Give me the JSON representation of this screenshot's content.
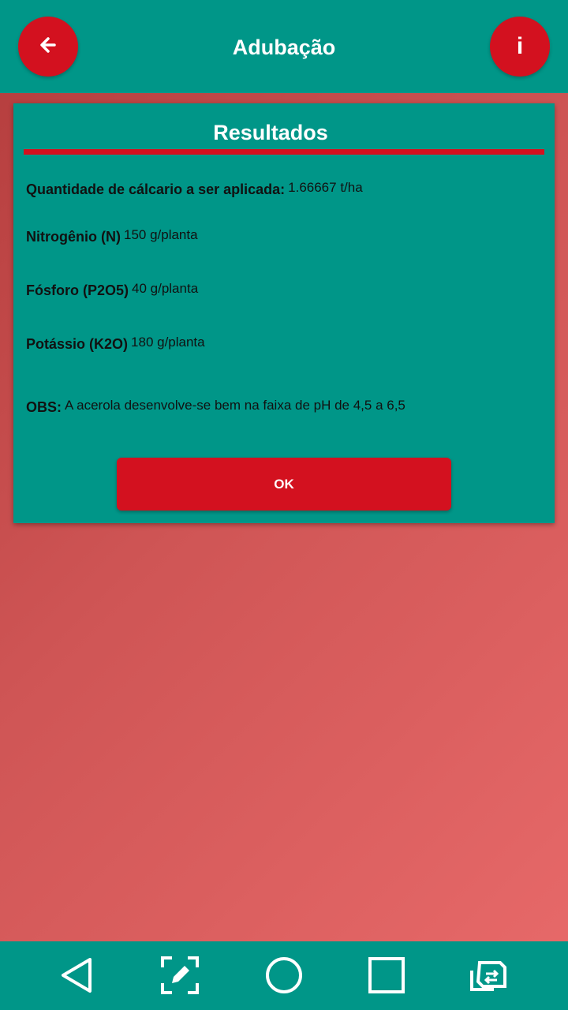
{
  "header": {
    "title": "Adubação",
    "back_icon": "arrow-left-icon",
    "info_label": "i"
  },
  "card": {
    "title": "Resultados",
    "rows": [
      {
        "label": "Quantidade de cálcario a ser aplicada:",
        "value": "1.66667 t/ha"
      },
      {
        "label": "Nitrogênio (N)",
        "value": "150 g/planta"
      },
      {
        "label": "Fósforo (P2O5)",
        "value": "40 g/planta"
      },
      {
        "label": "Potássio (K2O)",
        "value": "180 g/planta"
      },
      {
        "label": "OBS:",
        "value": "A acerola desenvolve-se bem na faixa de pH de 4,5 a 6,5"
      }
    ],
    "ok_label": "OK"
  },
  "nav": {
    "icons": [
      "back-triangle-icon",
      "screenshot-icon",
      "home-circle-icon",
      "recents-square-icon",
      "switch-icon"
    ]
  },
  "colors": {
    "primary": "#009688",
    "accent": "#d3111f"
  }
}
